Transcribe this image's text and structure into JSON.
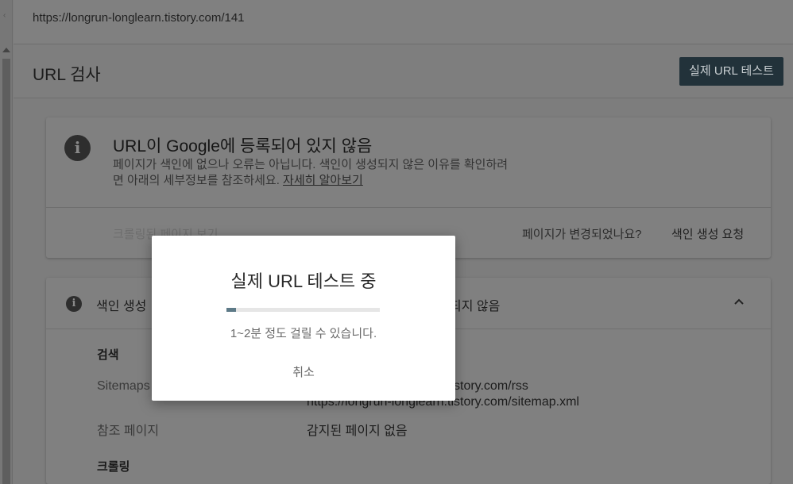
{
  "url_bar": {
    "url": "https://longrun-longlearn.tistory.com/141"
  },
  "header": {
    "title": "URL 검사",
    "live_test_button": "실제 URL 테스트"
  },
  "status_card": {
    "title": "URL이 Google에 등록되어 있지 않음",
    "description_line1": "페이지가 색인에 없으나 오류는 아닙니다. 색인이 생성되지 않은 이유를 확인하려",
    "description_line2": "면 아래의 세부정보를 참조하세요.",
    "learn_more": "자세히 알아보기",
    "crawled_page_link": "크롤링된 페이지 보기",
    "page_changed": "페이지가 변경되었나요?",
    "request_indexing": "색인 생성 요청"
  },
  "coverage_card": {
    "title": "색인 생성",
    "status": "되지 않음",
    "search_heading": "검색",
    "sitemaps_label": "Sitemaps",
    "sitemaps_values": [
      "https://longrun-longlearn.tistory.com/rss",
      "https://longrun-longlearn.tistory.com/sitemap.xml"
    ],
    "referring_label": "참조 페이지",
    "referring_value": "감지된 페이지 없음",
    "crawl_heading": "크롤링"
  },
  "modal": {
    "title": "실제 URL 테스트 중",
    "progress_fraction": 0.06,
    "subtitle": "1~2분 정도 걸릴 수 있습니다.",
    "cancel": "취소"
  },
  "colors": {
    "accent": "#5d7a87",
    "button_bg": "#22323a"
  }
}
